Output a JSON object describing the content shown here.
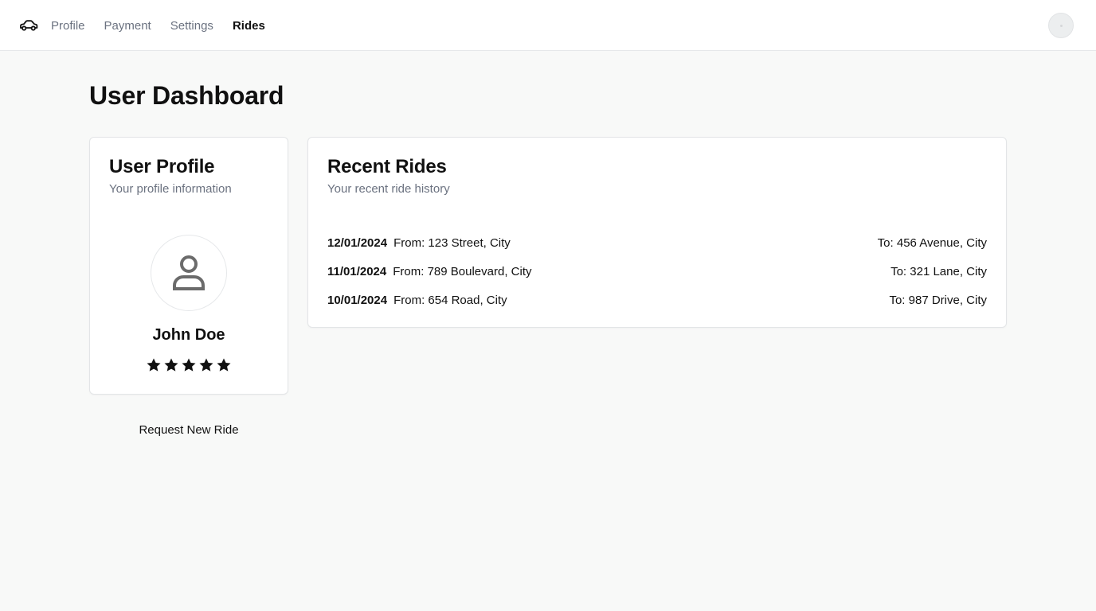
{
  "nav": {
    "links": [
      {
        "label": "Profile",
        "active": false
      },
      {
        "label": "Payment",
        "active": false
      },
      {
        "label": "Settings",
        "active": false
      },
      {
        "label": "Rides",
        "active": true
      }
    ]
  },
  "page": {
    "title": "User Dashboard"
  },
  "profile_card": {
    "title": "User Profile",
    "subtitle": "Your profile information",
    "name": "John Doe",
    "rating": 5,
    "rating_max": 5
  },
  "rides_card": {
    "title": "Recent Rides",
    "subtitle": "Your recent ride history",
    "rides": [
      {
        "date": "12/01/2024",
        "from": "From: 123 Street, City",
        "to": "To: 456 Avenue, City"
      },
      {
        "date": "11/01/2024",
        "from": "From: 789 Boulevard, City",
        "to": "To: 321 Lane, City"
      },
      {
        "date": "10/01/2024",
        "from": "From: 654 Road, City",
        "to": "To: 987 Drive, City"
      }
    ]
  },
  "actions": {
    "request_ride_label": "Request New Ride"
  },
  "icons": {
    "logo": "car-icon",
    "avatar": "user-icon",
    "rating": "star-icon"
  },
  "colors": {
    "background": "#f8f9f8",
    "card": "#ffffff",
    "text": "#111111",
    "muted": "#6b7280",
    "border": "#e3e5e7"
  }
}
